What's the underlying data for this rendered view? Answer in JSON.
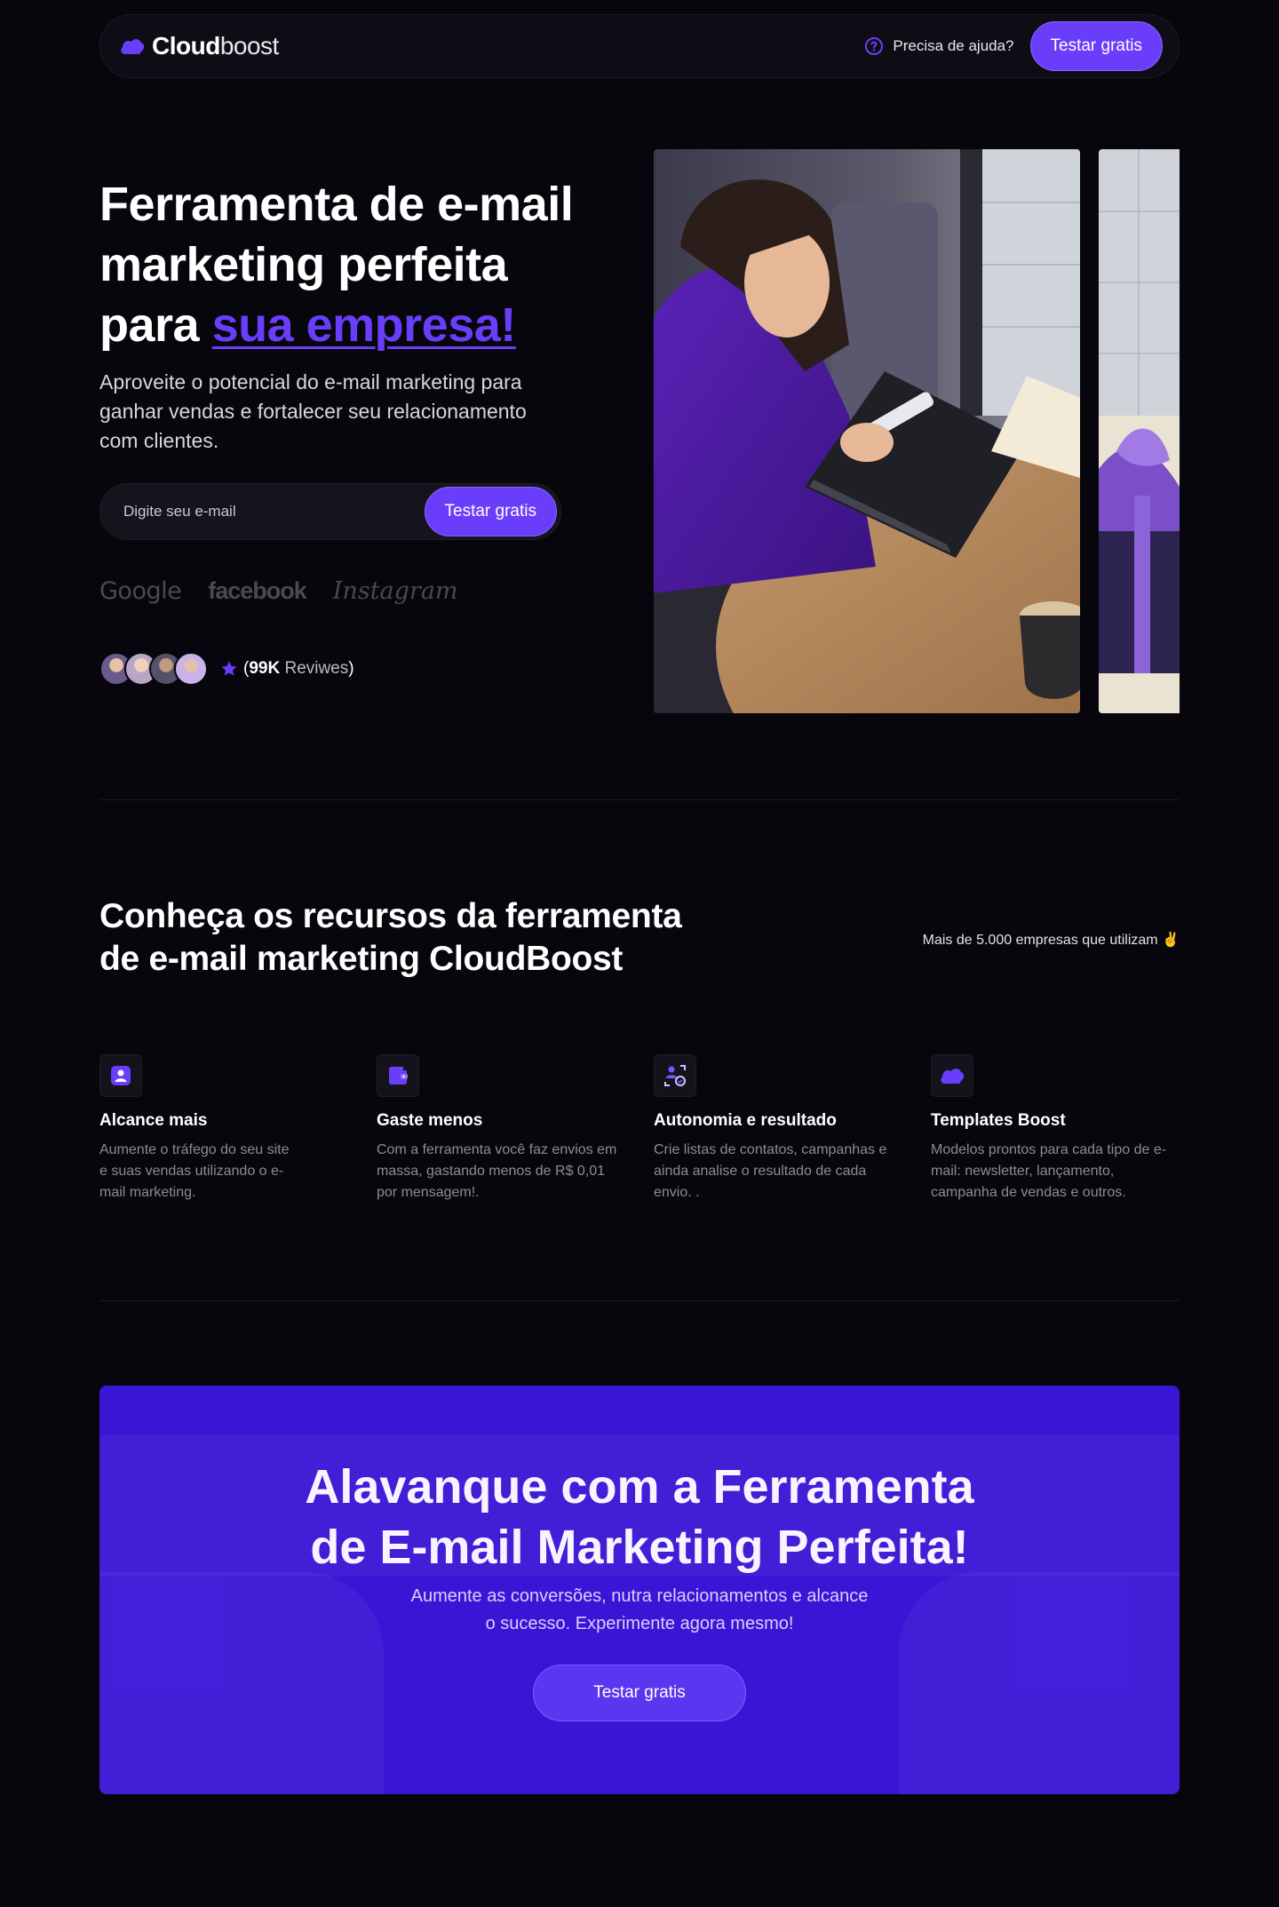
{
  "brand": {
    "name_bold": "Cloud",
    "name_light": "boost",
    "logo_icon": "cloud-icon",
    "accent_color": "#6a3dfa"
  },
  "nav": {
    "help_label": "Precisa de ajuda?",
    "cta_label": "Testar gratis"
  },
  "hero": {
    "title_line1": "Ferramenta de e-mail",
    "title_line2": "marketing perfeita",
    "title_line3_prefix": "para ",
    "title_highlight": "sua empresa!",
    "subtitle": "Aproveite o potencial do e-mail marketing para ganhar vendas e fortalecer seu relacionamento com clientes.",
    "email_placeholder": "Digite seu e-mail",
    "cta_label": "Testar gratis",
    "partner_logos": [
      "Google",
      "facebook",
      "Instagram"
    ],
    "rating": {
      "open": "(",
      "count": "99K",
      "label": " Reviwes",
      "close": ")"
    }
  },
  "features": {
    "title_line1": "Conheça os recursos da ferramenta",
    "title_line2": "de e-mail marketing CloudBoost",
    "note": "Mais de 5.000 empresas que utilizam ✌️",
    "items": [
      {
        "icon": "user-badge-icon",
        "title": "Alcance mais",
        "description": "Aumente o tráfego do seu site e suas vendas utilizando o e-mail marketing."
      },
      {
        "icon": "wallet-icon",
        "title": "Gaste menos",
        "description": "Com a ferramenta você faz envios em massa, gastando menos de R$ 0,01 por mensagem!."
      },
      {
        "icon": "user-scan-icon",
        "title": "Autonomia e resultado",
        "description": "Crie listas de contatos, campanhas e ainda analise o resultado de cada envio. ."
      },
      {
        "icon": "template-icon",
        "title": "Templates Boost",
        "description": "Modelos prontos para cada tipo de e-mail: newsletter, lançamento, campanha de vendas e outros."
      }
    ]
  },
  "cta": {
    "title_line1": "Alavanque com a Ferramenta",
    "title_line2": "de E-mail Marketing Perfeita!",
    "subtitle": "Aumente as conversões, nutra relacionamentos e alcance o sucesso. Experimente agora mesmo!",
    "button_label": "Testar gratis",
    "background_color": "#3a15d6"
  }
}
